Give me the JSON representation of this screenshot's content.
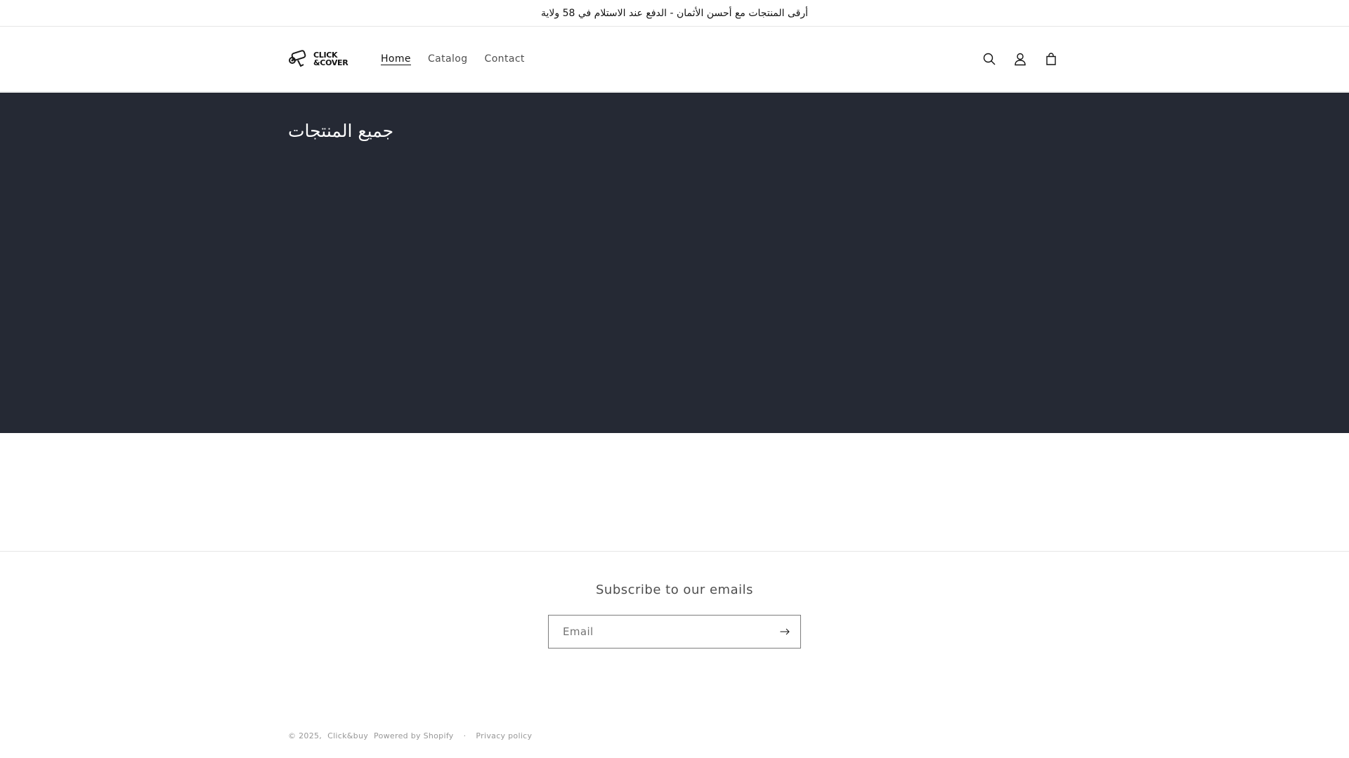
{
  "announcement": {
    "text": "أرقى المنتجات مع أحسن الأثمان - الدفع عند الاستلام في 58 ولاية"
  },
  "header": {
    "logo": {
      "line1": "CLICK",
      "line2": "&COVER"
    },
    "nav": [
      {
        "label": "Home",
        "active": true
      },
      {
        "label": "Catalog",
        "active": false
      },
      {
        "label": "Contact",
        "active": false
      }
    ],
    "icons": [
      "search-icon",
      "account-icon",
      "cart-icon"
    ]
  },
  "banner": {
    "title": "جميع المنتجات",
    "background": "#252934"
  },
  "newsletter": {
    "heading": "Subscribe to our emails",
    "email_placeholder": "Email",
    "submit_icon": "arrow-right-icon"
  },
  "footer": {
    "copyright": "© 2025,",
    "store_name": "Click&buy",
    "powered_by": "Powered by Shopify",
    "separator": "·",
    "privacy": "Privacy policy"
  }
}
